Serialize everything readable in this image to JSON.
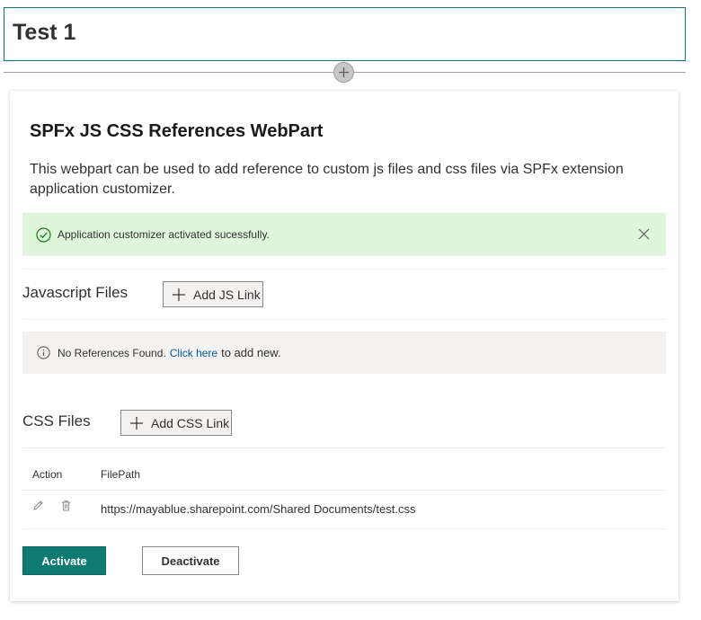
{
  "page": {
    "title": "Test 1"
  },
  "webpart": {
    "title": "SPFx JS CSS References WebPart",
    "description": "This webpart can be used to add reference to custom js files and css files via SPFx extension application customizer.",
    "success_message": "Application customizer activated sucessfully.",
    "js_section": {
      "label": "Javascript Files",
      "add_button": "Add JS Link",
      "empty_message": "No References Found.",
      "empty_link": "Click here",
      "empty_tail": "to add new."
    },
    "css_section": {
      "label": "CSS Files",
      "add_button": "Add CSS Link",
      "columns": [
        "Action",
        "FilePath"
      ],
      "rows": [
        {
          "file_path": "https://mayablue.sharepoint.com/Shared Documents/test.css"
        }
      ]
    },
    "actions": {
      "activate": "Activate",
      "deactivate": "Deactivate"
    }
  },
  "colors": {
    "accent": "#0e7a72",
    "success_bg": "#dff6dd",
    "info_bg": "#f3f2f1",
    "link": "#005a9e"
  },
  "icons": {
    "add_section": "plus-icon",
    "success": "check-circle-icon",
    "dismiss": "close-icon",
    "info": "info-icon",
    "edit": "pencil-icon",
    "delete": "trash-icon"
  }
}
